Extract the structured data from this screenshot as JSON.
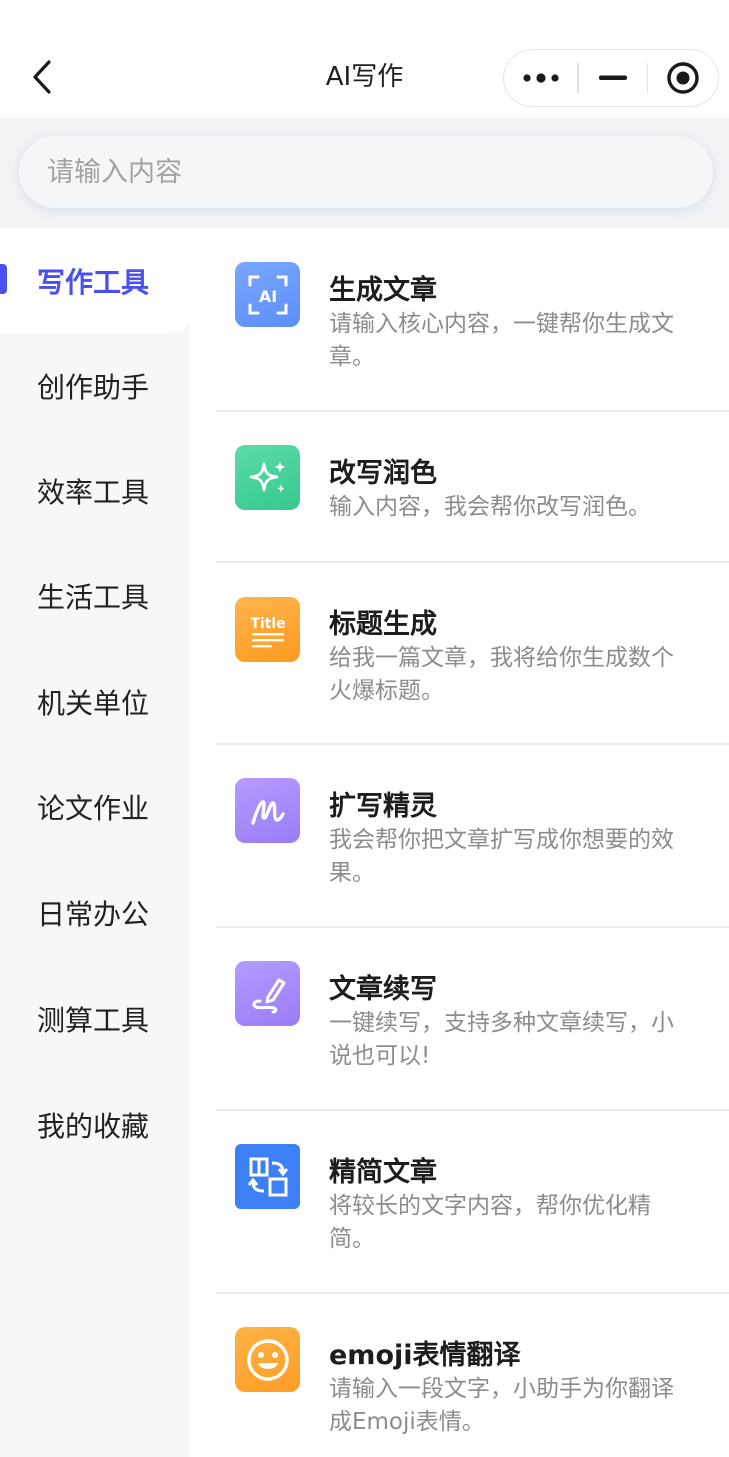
{
  "header": {
    "title": "AI写作"
  },
  "search": {
    "placeholder": "请输入内容"
  },
  "sidebar": {
    "items": [
      {
        "label": "写作工具"
      },
      {
        "label": "创作助手"
      },
      {
        "label": "效率工具"
      },
      {
        "label": "生活工具"
      },
      {
        "label": "机关单位"
      },
      {
        "label": "论文作业"
      },
      {
        "label": "日常办公"
      },
      {
        "label": "测算工具"
      },
      {
        "label": "我的收藏"
      }
    ],
    "active_index": 0
  },
  "icons": {
    "back": "chevron-left-icon",
    "more": "more-dots-icon",
    "minimize": "minimize-icon",
    "close": "target-circle-icon"
  },
  "tools": [
    {
      "name": "生成文章",
      "desc": "请输入核心内容，一键帮你生成文章。",
      "icon": "ai-frame-icon",
      "color_from": "#5b8ff9",
      "color_to": "#7aa6ff",
      "icon_text": "AI"
    },
    {
      "name": "改写润色",
      "desc": "输入内容，我会帮你改写润色。",
      "icon": "sparkle-icon",
      "color_from": "#35c98e",
      "color_to": "#5ddba8"
    },
    {
      "name": "标题生成",
      "desc": "给我一篇文章，我将给你生成数个火爆标题。",
      "icon": "title-icon",
      "color_from": "#ff9a1f",
      "color_to": "#ffb54d",
      "icon_text": "Title"
    },
    {
      "name": "扩写精灵",
      "desc": "我会帮你把文章扩写成你想要的效果。",
      "icon": "handwriting-icon",
      "color_from": "#9a7cf5",
      "color_to": "#b59cff"
    },
    {
      "name": "文章续写",
      "desc": "一键续写，支持多种文章续写，小说也可以!",
      "icon": "pen-icon",
      "color_from": "#9a7cf5",
      "color_to": "#b49cff"
    },
    {
      "name": "精简文章",
      "desc": "将较长的文字内容，帮你优化精简。",
      "icon": "convert-icon",
      "color_from": "#3d7ff5",
      "color_to": "#3d7ff5"
    },
    {
      "name": "emoji表情翻译",
      "desc": "请输入一段文字，小助手为你翻译成Emoji表情。",
      "icon": "smiley-icon",
      "color_from": "#ff9d24",
      "color_to": "#ffb347"
    }
  ]
}
